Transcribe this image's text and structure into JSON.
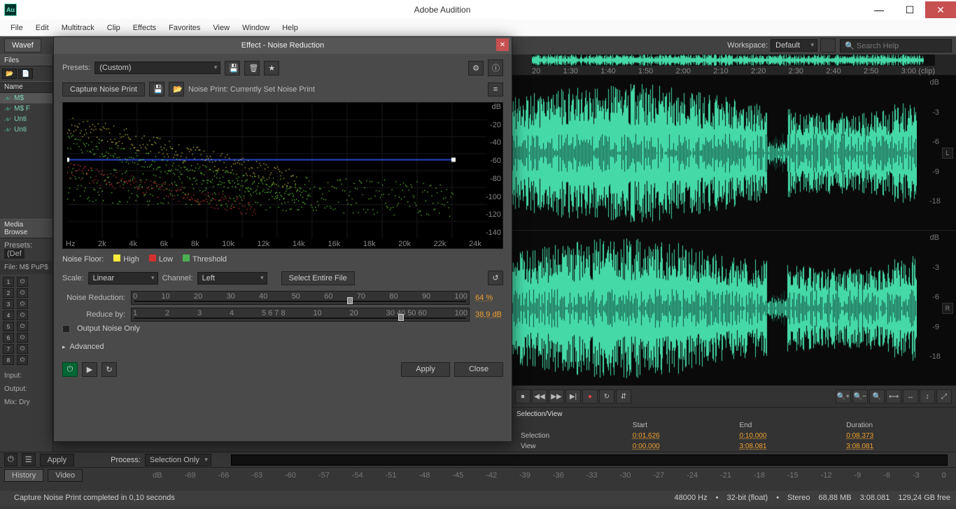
{
  "titlebar": {
    "app_name": "Adobe Audition",
    "logo": "Au"
  },
  "menubar": [
    "File",
    "Edit",
    "Multitrack",
    "Clip",
    "Effects",
    "Favorites",
    "View",
    "Window",
    "Help"
  ],
  "toolbar": {
    "tab_waveform": "Wavef",
    "workspace_label": "Workspace:",
    "workspace_value": "Default",
    "search_placeholder": "Search Help"
  },
  "leftcol": {
    "files_label": "Files",
    "name_header": "Name",
    "files": [
      "M$",
      "M$ F",
      "Unti",
      "Unti"
    ],
    "media_browse": "Media Browse",
    "presets_label": "Presets:",
    "presets_value": "(Def",
    "file_label": "File: M$ PuP$",
    "track_numbers": [
      1,
      2,
      3,
      4,
      5,
      6,
      7,
      8
    ],
    "input_label": "Input:",
    "output_label": "Output:",
    "mix_label": "Mix:   Dry"
  },
  "dialog": {
    "title": "Effect - Noise Reduction",
    "presets_label": "Presets:",
    "preset_value": "(Custom)",
    "capture_btn": "Capture Noise Print",
    "noiseprint_label": "Noise Print:  Currently Set Noise Print",
    "spectrum_y": [
      "dB",
      "-20",
      "-40",
      "-60",
      "-80",
      "-100",
      "-120",
      "-140"
    ],
    "spectrum_x": [
      "Hz",
      "2k",
      "4k",
      "6k",
      "8k",
      "10k",
      "12k",
      "14k",
      "16k",
      "18k",
      "20k",
      "22k",
      "24k"
    ],
    "legend_noisefloor": "Noise Floor:",
    "legend_high": "High",
    "legend_low": "Low",
    "legend_threshold": "Threshold",
    "scale_label": "Scale:",
    "scale_value": "Linear",
    "channel_label": "Channel:",
    "channel_value": "Left",
    "select_entire_btn": "Select Entire File",
    "noise_reduction_label": "Noise Reduction:",
    "noise_reduction_value": "64",
    "nr_unit": "%",
    "nr_ticks": [
      "0",
      "10",
      "20",
      "30",
      "40",
      "50",
      "60",
      "70",
      "80",
      "90",
      "100"
    ],
    "reduce_by_label": "Reduce by:",
    "reduce_by_value": "38,9",
    "rb_unit": "dB",
    "rb_ticks": [
      "1",
      "2",
      "3",
      "4",
      "5 6 7 8",
      "10",
      "20",
      "30 40 50 60",
      "100"
    ],
    "output_noise_only": "Output Noise Only",
    "advanced": "Advanced",
    "apply": "Apply",
    "close": "Close"
  },
  "timeline": {
    "ticks": [
      "20",
      "1:30",
      "1:40",
      "1:50",
      "2:00",
      "2:10",
      "2:20",
      "2:30",
      "2:40",
      "2:50",
      "3:00 (clip)"
    ]
  },
  "dbscale": [
    "dB",
    "-3",
    "-6",
    "-9",
    "-18",
    "",
    "-18",
    "-9",
    "-6",
    "-3",
    "dB"
  ],
  "transport_icons": [
    "⏹",
    "◀◀",
    "▶▶",
    "▶|",
    "●",
    "↻",
    "⇵"
  ],
  "zoom_icons": [
    "🔍+",
    "🔍−",
    "🔍",
    "⟷",
    "↔",
    "↕",
    "⤢"
  ],
  "selection_panel": {
    "title": "Selection/View",
    "header_start": "Start",
    "header_end": "End",
    "header_duration": "Duration",
    "sel_label": "Selection",
    "sel_start": "0:01.626",
    "sel_end": "0:10.000",
    "sel_dur": "0:08.373",
    "view_label": "View",
    "view_start": "0:00.000",
    "view_end": "3:08.081",
    "view_dur": "3:08.081"
  },
  "bottom": {
    "apply": "Apply",
    "process_label": "Process:",
    "process_value": "Selection Only",
    "history": "History",
    "video": "Video",
    "level_ticks": [
      "dB",
      "-69",
      "-66",
      "-63",
      "-60",
      "-57",
      "-54",
      "-51",
      "-48",
      "-45",
      "-42",
      "-39",
      "-36",
      "-33",
      "-30",
      "-27",
      "-24",
      "-21",
      "-18",
      "-15",
      "-12",
      "-9",
      "-6",
      "-3",
      "0"
    ]
  },
  "statusbar": {
    "message": "Capture Noise Print completed in 0,10 seconds",
    "sr": "48000 Hz",
    "bit": "32-bit (float)",
    "ch": "Stereo",
    "mem": "68,88 MB",
    "dur": "3:08.081",
    "disk": "129,24 GB free"
  }
}
